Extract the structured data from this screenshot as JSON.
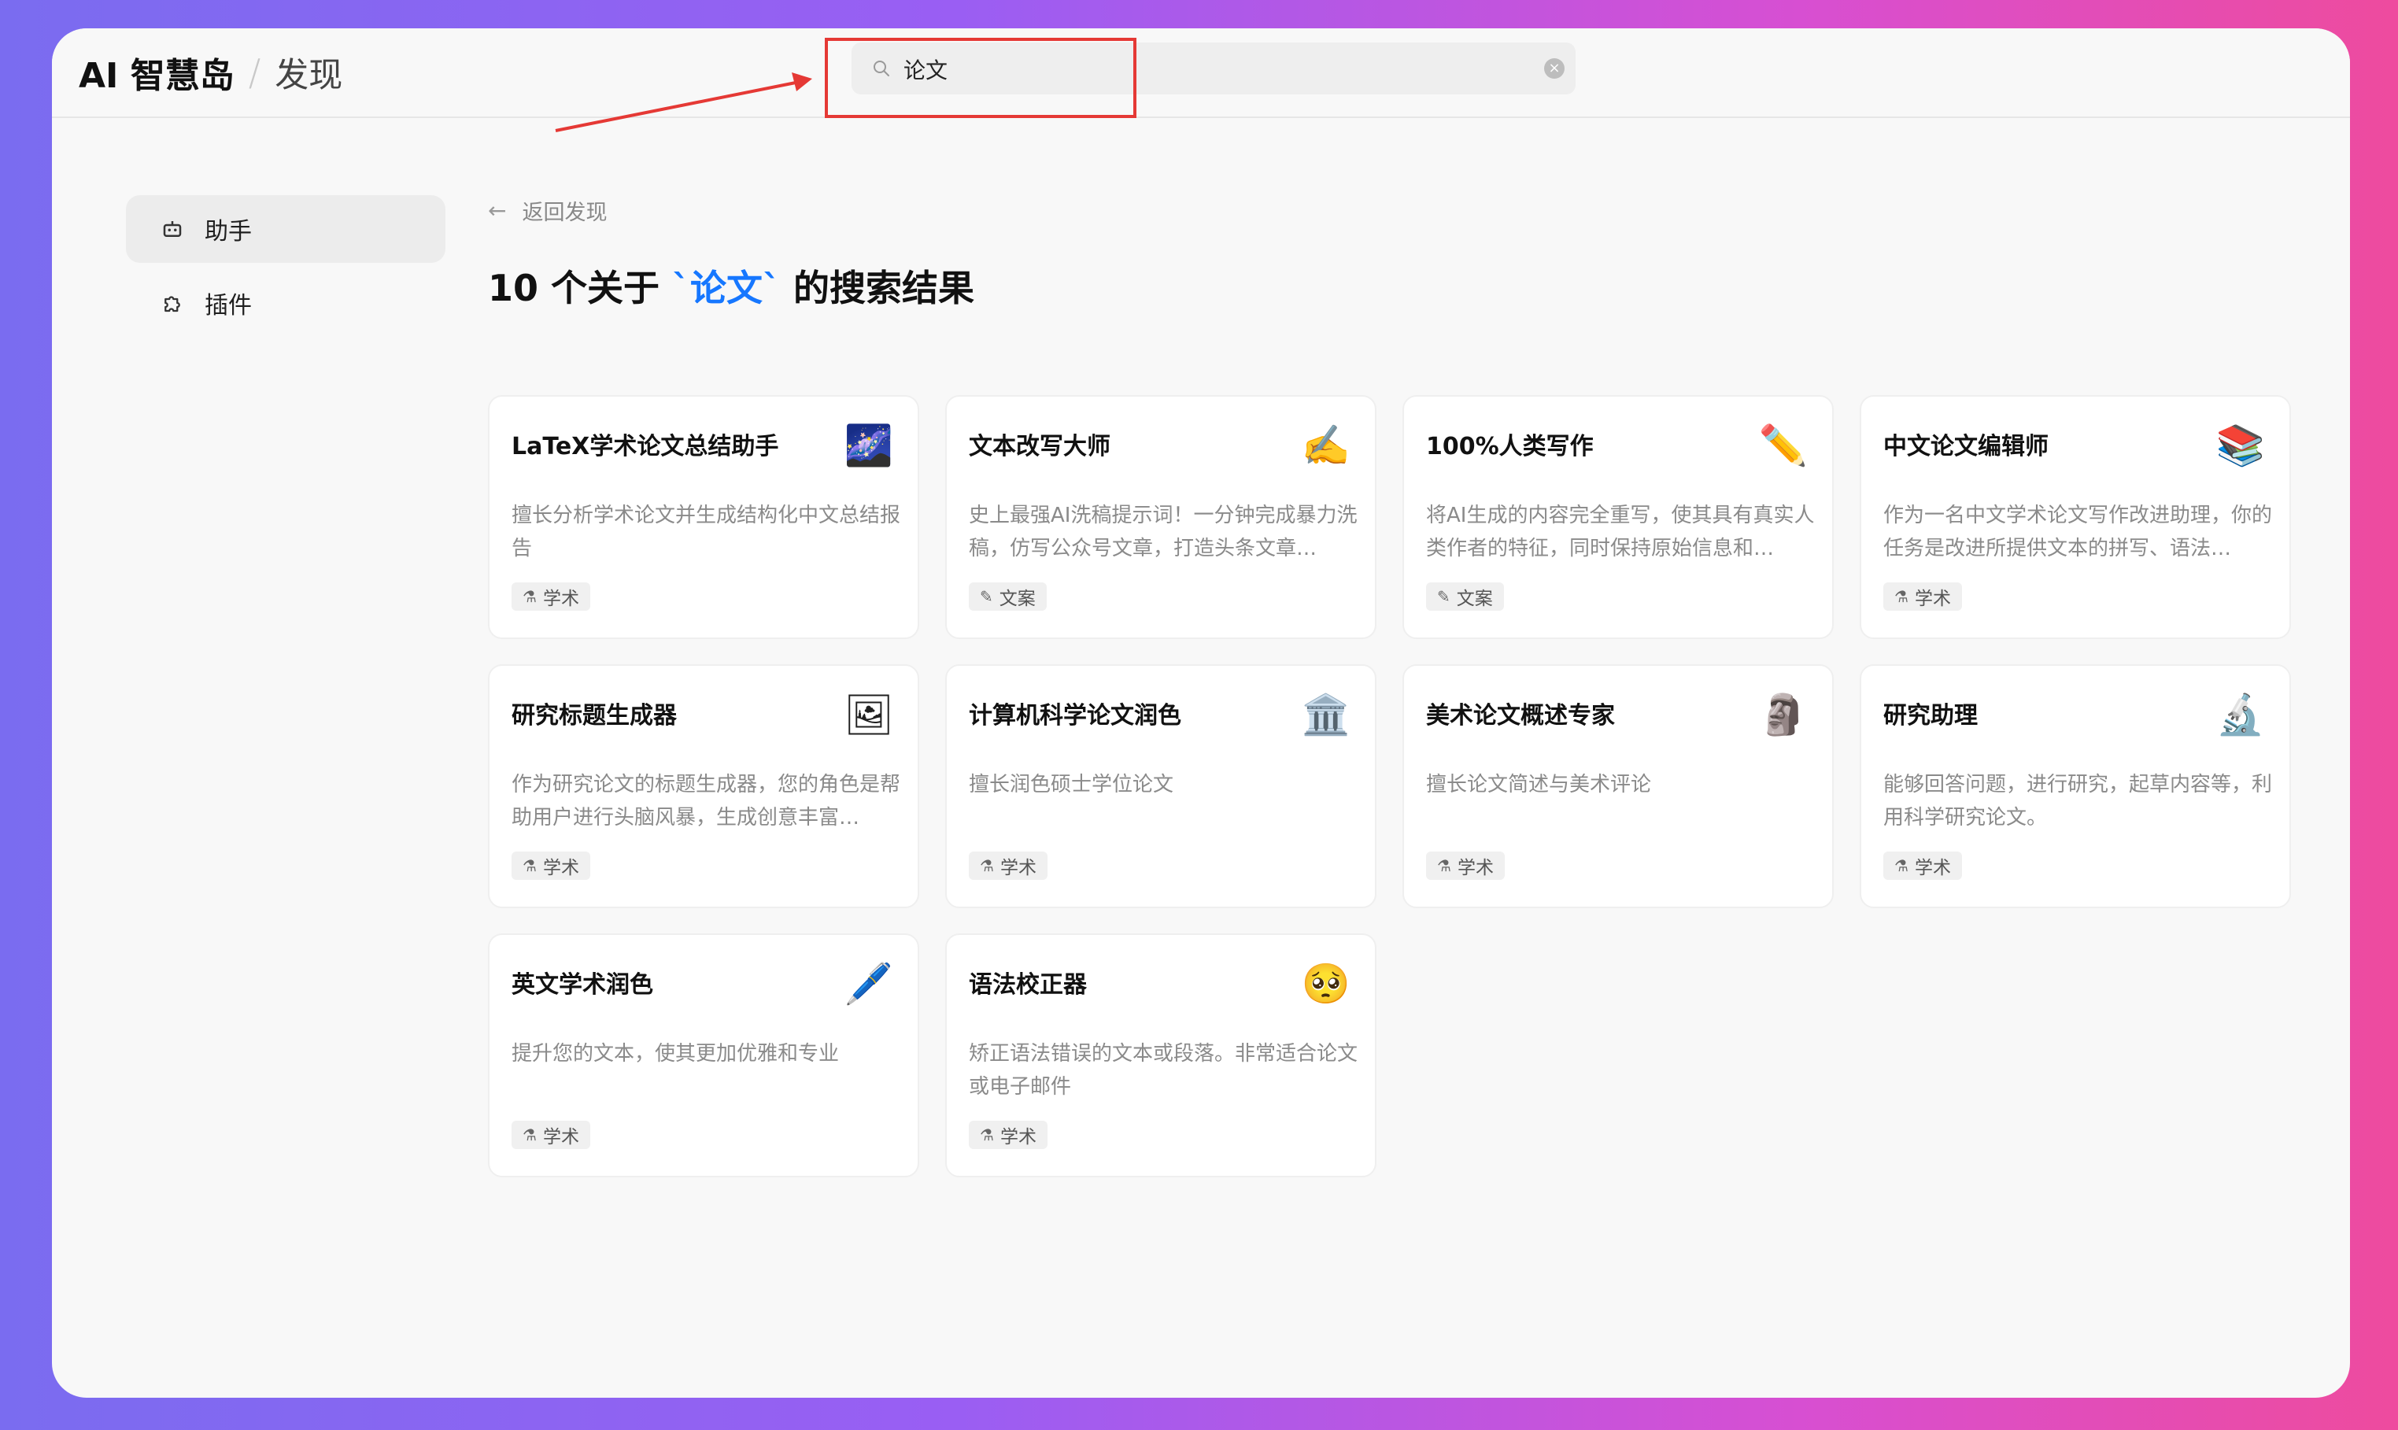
{
  "brand": {
    "name": "AI 智慧岛",
    "separator": "/",
    "section": "发现"
  },
  "search": {
    "value": "论文",
    "placeholder": ""
  },
  "sidebar": {
    "items": [
      {
        "label": "助手",
        "icon": "robot-icon",
        "active": true
      },
      {
        "label": "插件",
        "icon": "puzzle-icon",
        "active": false
      }
    ]
  },
  "main": {
    "back_label": "返回发现",
    "result": {
      "prefix": "10 个关于 ",
      "keyword": "`论文`",
      "suffix": " 的搜索结果"
    }
  },
  "cards": [
    {
      "title": "LaTeX学术论文总结助手",
      "emoji": "🌌",
      "icon": "galaxy-icon",
      "desc": "擅长分析学术论文并生成结构化中文总结报告",
      "tag": "学术"
    },
    {
      "title": "文本改写大师",
      "emoji": "✍️",
      "icon": "writing-hand-icon",
      "desc": "史上最强AI洗稿提示词！一分钟完成暴力洗稿，仿写公众号文章，打造头条文章…",
      "tag": "文案"
    },
    {
      "title": "100%人类写作",
      "emoji": "✏️",
      "icon": "pencil-icon",
      "desc": "将AI生成的内容完全重写，使其具有真实人类作者的特征，同时保持原始信息和…",
      "tag": "文案"
    },
    {
      "title": "中文论文编辑师",
      "emoji": "📚",
      "icon": "books-icon",
      "desc": "作为一名中文学术论文写作改进助理，你的任务是改进所提供文本的拼写、语法…",
      "tag": "学术"
    },
    {
      "title": "研究标题生成器",
      "emoji": "🖼",
      "icon": "broken-image-icon",
      "desc": "作为研究论文的标题生成器，您的角色是帮助用户进行头脑风暴，生成创意丰富…",
      "tag": "学术"
    },
    {
      "title": "计算机科学论文润色",
      "emoji": "🏛️",
      "icon": "classical-building-icon",
      "desc": "擅长润色硕士学位论文",
      "tag": "学术"
    },
    {
      "title": "美术论文概述专家",
      "emoji": "🗿",
      "icon": "moai-icon",
      "desc": "擅长论文简述与美术评论",
      "tag": "学术"
    },
    {
      "title": "研究助理",
      "emoji": "🔬",
      "icon": "microscope-icon",
      "desc": "能够回答问题，进行研究，起草内容等，利用科学研究论文。",
      "tag": "学术"
    },
    {
      "title": "英文学术润色",
      "emoji": "🖊️",
      "icon": "pen-icon",
      "desc": "提升您的文本，使其更加优雅和专业",
      "tag": "学术"
    },
    {
      "title": "语法校正器",
      "emoji": "🥺",
      "icon": "pleading-face-icon",
      "desc": "矫正语法错误的文本或段落。非常适合论文或电子邮件",
      "tag": "学术"
    }
  ],
  "colors": {
    "accent": "#1677ff",
    "highlight_box": "#e53935"
  }
}
